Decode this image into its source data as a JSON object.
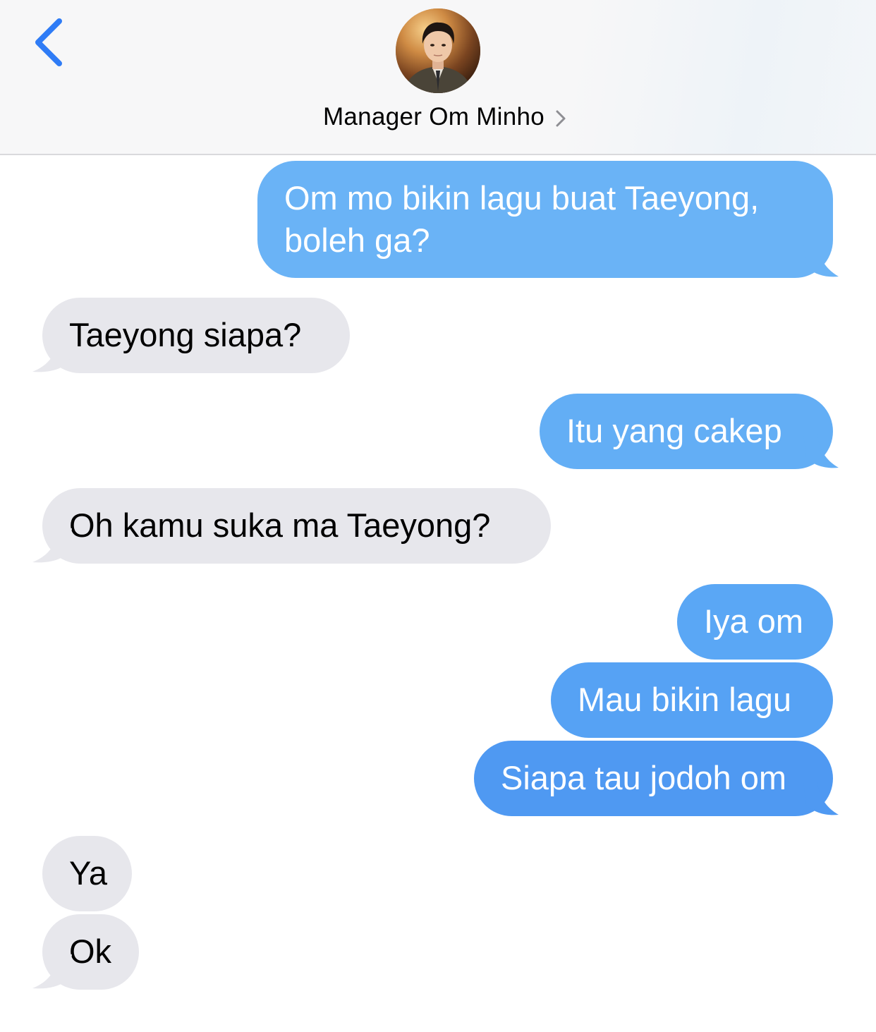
{
  "header": {
    "contact_name": "Manager Om Minho"
  },
  "colors": {
    "sent_bubble": "#62aef5",
    "sent_bubble_dark": "#4f99f2",
    "received_bubble": "#e7e7ec",
    "back_chevron": "#2f7cf6"
  },
  "icons": {
    "back": "chevron-left-icon",
    "contact_detail": "chevron-right-icon"
  },
  "messages": [
    {
      "direction": "sent",
      "text_line_1": "Om mo bikin lagu buat Taeyong,",
      "text_line_2": "boleh ga?"
    },
    {
      "direction": "received",
      "text": "Taeyong siapa?"
    },
    {
      "direction": "sent",
      "text": "Itu yang cakep"
    },
    {
      "direction": "received",
      "text": "Oh kamu suka ma Taeyong?"
    },
    {
      "direction": "sent",
      "text": "Iya om"
    },
    {
      "direction": "sent",
      "text": "Mau bikin lagu"
    },
    {
      "direction": "sent",
      "text": "Siapa tau jodoh om"
    },
    {
      "direction": "received",
      "text": "Ya"
    },
    {
      "direction": "received",
      "text": "Ok"
    }
  ]
}
